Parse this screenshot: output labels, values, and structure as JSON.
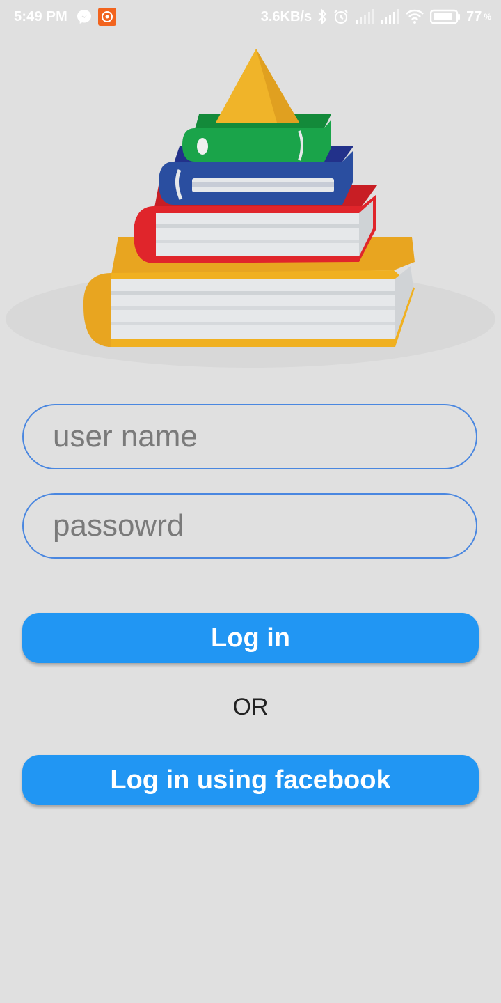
{
  "status_bar": {
    "time": "5:49 PM",
    "net_speed": "3.6KB/s",
    "battery_level": "77",
    "battery_unit": "%",
    "icons": [
      "messenger-icon",
      "app-notification-icon",
      "bluetooth-icon",
      "alarm-icon",
      "signal-icon",
      "signal-icon",
      "wifi-icon",
      "battery-icon"
    ]
  },
  "hero": {
    "image": "stack-of-books-illustration",
    "colors": {
      "triangle": "#f0b429",
      "green_book": "#1aa44a",
      "blue_book": "#2a4ea0",
      "red_book": "#e0252b",
      "yellow_book": "#f0b020"
    }
  },
  "login_form": {
    "username_placeholder": "user name",
    "password_placeholder": "passowrd",
    "login_label": "Log in",
    "or_label": "OR",
    "facebook_label": "Log in using facebook"
  },
  "colors": {
    "background": "#e0e0e0",
    "accent": "#2196f3",
    "field_border": "#4a87e0"
  }
}
